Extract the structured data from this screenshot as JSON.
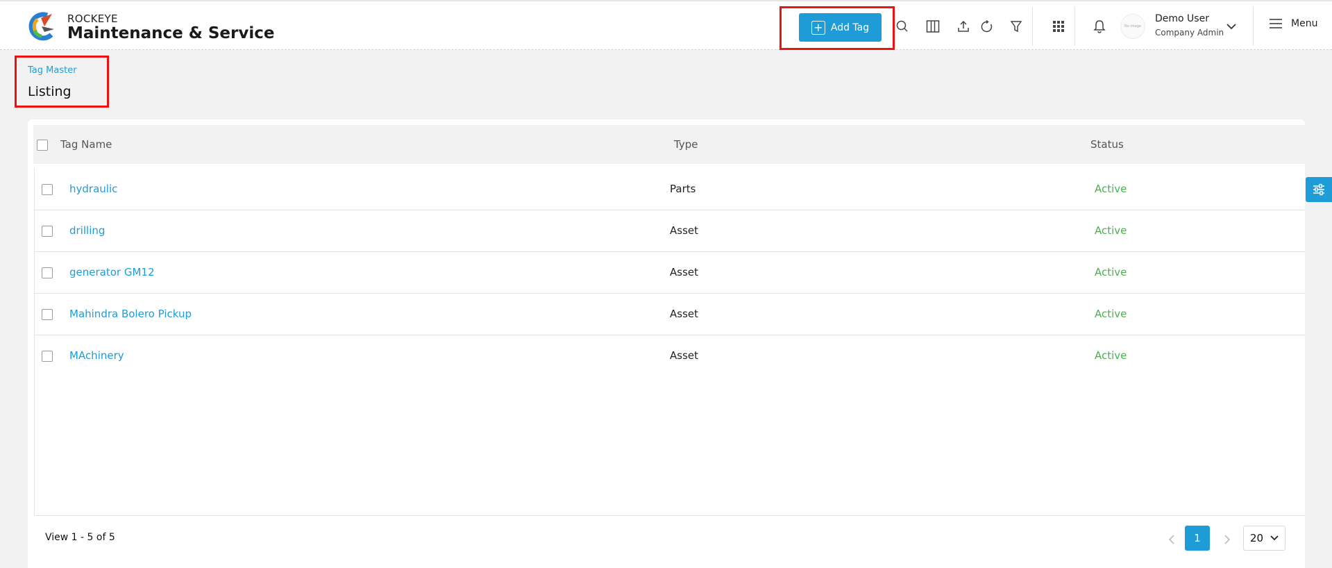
{
  "app": {
    "brand_small": "ROCKEYE",
    "brand_big": "Maintenance & Service"
  },
  "toolbar": {
    "add_tag_label": "Add Tag",
    "icons": [
      "search-icon",
      "columns-icon",
      "upload-icon",
      "refresh-icon",
      "filter-icon",
      "apps-grid-icon",
      "bell-icon"
    ]
  },
  "user": {
    "name": "Demo User",
    "role": "Company Admin",
    "avatar_text": "No image"
  },
  "menu": {
    "label": "Menu"
  },
  "breadcrumb": {
    "parent": "Tag Master",
    "title": "Listing"
  },
  "table": {
    "columns": {
      "name": "Tag Name",
      "type": "Type",
      "status": "Status"
    },
    "rows": [
      {
        "name": "hydraulic",
        "type": "Parts",
        "status": "Active"
      },
      {
        "name": "drilling",
        "type": "Asset",
        "status": "Active"
      },
      {
        "name": "generator GM12",
        "type": "Asset",
        "status": "Active"
      },
      {
        "name": "Mahindra Bolero Pickup",
        "type": "Asset",
        "status": "Active"
      },
      {
        "name": "MAchinery",
        "type": "Asset",
        "status": "Active"
      }
    ]
  },
  "pagination": {
    "view_text": "View 1 - 5 of 5",
    "current_page": "1",
    "page_size": "20"
  },
  "colors": {
    "accent": "#1e9cd7",
    "status_active": "#4caf50",
    "highlight": "#e11111"
  }
}
